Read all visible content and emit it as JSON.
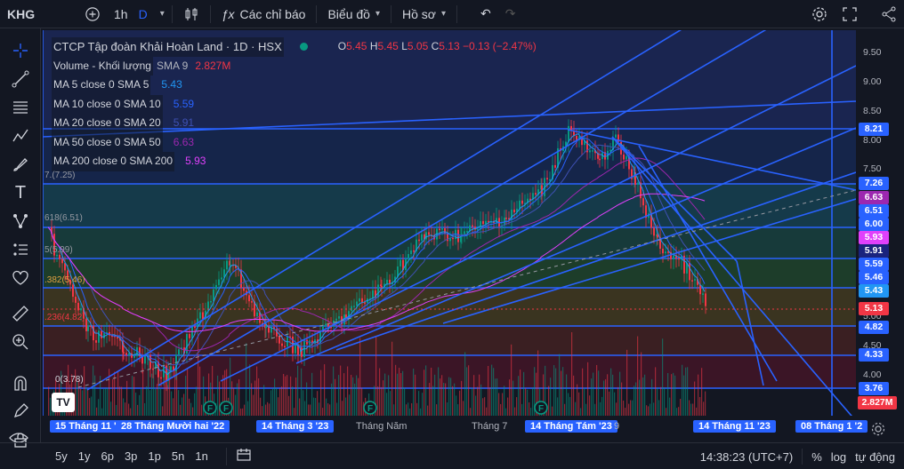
{
  "topbar": {
    "symbol": "KHG",
    "interval": "1h",
    "interval_d": "D",
    "indicators": "Các chỉ báo",
    "chart_type": "Biểu đồ",
    "profile": "Hồ sơ"
  },
  "legend": {
    "title": "CTCP Tập đoàn Khải Hoàn Land · 1D · HSX",
    "ohlc": {
      "o_label": "O",
      "o": "5.45",
      "h_label": "H",
      "h": "5.45",
      "l_label": "L",
      "l": "5.05",
      "c_label": "C",
      "c": "5.13",
      "chg": "−0.13 (−2.47%)"
    },
    "rows": [
      {
        "label": "Volume - Khối lượng",
        "sub": "SMA 9",
        "value": "2.827M",
        "color": "#f23645"
      },
      {
        "label": "MA 5 close 0 SMA 5",
        "sub": "",
        "value": "5.43",
        "color": "#2196f3"
      },
      {
        "label": "MA 10 close 0 SMA 10",
        "sub": "",
        "value": "5.59",
        "color": "#2962ff"
      },
      {
        "label": "MA 20 close 0 SMA 20",
        "sub": "",
        "value": "5.91",
        "color": "#3f51b5"
      },
      {
        "label": "MA 50 close 0 SMA 50",
        "sub": "",
        "value": "6.63",
        "color": "#9c27b0"
      },
      {
        "label": "MA 200 close 0 SMA 200",
        "sub": "",
        "value": "5.93",
        "color": "#e040fb"
      }
    ]
  },
  "fib_labels": [
    "7.(7.25)",
    "618(6.51)",
    "5(5.99)",
    ".382(5.46)",
    ".236(4.82)",
    "0(3.78)"
  ],
  "price_ticks": [
    "9.50",
    "9.00",
    "8.50",
    "8.00",
    "7.50",
    "5.00",
    "4.50",
    "4.00"
  ],
  "price_labels": [
    {
      "text": "8.21",
      "color": "#2962ff"
    },
    {
      "text": "7.26",
      "color": "#2962ff"
    },
    {
      "text": "6.63",
      "color": "#9c27b0"
    },
    {
      "text": "6.51",
      "color": "#2962ff"
    },
    {
      "text": "6.00",
      "color": "#2962ff"
    },
    {
      "text": "5.93",
      "color": "#e040fb"
    },
    {
      "text": "5.91",
      "color": "#1a237e"
    },
    {
      "text": "5.59",
      "color": "#2962ff"
    },
    {
      "text": "5.46",
      "color": "#2962ff"
    },
    {
      "text": "5.43",
      "color": "#2196f3"
    },
    {
      "text": "5.13",
      "color": "#f23645"
    },
    {
      "text": "4.82",
      "color": "#2962ff"
    },
    {
      "text": "4.33",
      "color": "#2962ff"
    },
    {
      "text": "3.76",
      "color": "#2962ff"
    },
    {
      "text": "2.827M",
      "color": "#f23645"
    }
  ],
  "time_labels": [
    {
      "text": "15 Tháng 11 '2",
      "hl": true
    },
    {
      "text": "28 Tháng Mười hai '22",
      "hl": true
    },
    {
      "text": "14 Tháng 3 '23",
      "hl": true
    },
    {
      "text": "Tháng Năm",
      "hl": false
    },
    {
      "text": "Tháng 7",
      "hl": false
    },
    {
      "text": "14 Tháng Tám '23",
      "hl": true
    },
    {
      "text": "9",
      "hl": false
    },
    {
      "text": "14 Tháng 11 '23",
      "hl": true
    },
    {
      "text": "08 Tháng 1 '2",
      "hl": true
    }
  ],
  "bottom": {
    "ranges": [
      "5y",
      "1y",
      "6p",
      "3p",
      "1p",
      "5n",
      "1n"
    ],
    "clock": "14:38:23 (UTC+7)",
    "percent": "%",
    "log": "log",
    "auto": "tự động"
  },
  "colors": {
    "accent": "#2962ff",
    "up": "#089981",
    "down": "#f23645",
    "bg": "#131722"
  }
}
